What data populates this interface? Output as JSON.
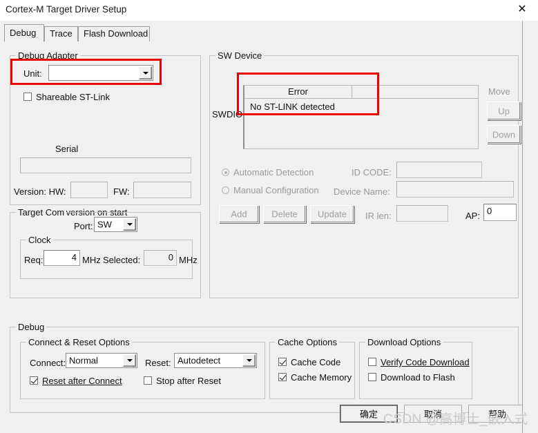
{
  "window": {
    "title": "Cortex-M Target Driver Setup",
    "close_label": "✕"
  },
  "tabs": [
    {
      "label": "Debug",
      "active": true
    },
    {
      "label": "Trace",
      "active": false
    },
    {
      "label": "Flash Download",
      "active": false
    }
  ],
  "debug_adapter": {
    "title": "Debug Adapter",
    "unit_label": "Unit:",
    "unit_value": "",
    "shareable_label": "Shareable ST-Link",
    "shareable_checked": false,
    "serial_label": "Serial",
    "serial_value": "",
    "version_label": "Version: HW:",
    "hw_value": "",
    "fw_label": "FW:",
    "fw_value": "",
    "check_version_label": "Check version on start",
    "check_version_checked": true
  },
  "target_com": {
    "title": "Target Com",
    "port_label": "Port:",
    "port_value": "SW",
    "clock": {
      "title": "Clock",
      "req_label": "Req:",
      "req_value": "4",
      "req_unit": "MHz",
      "selected_label": "Selected:",
      "selected_value": "0",
      "selected_unit": "MHz"
    }
  },
  "sw_device": {
    "title": "SW Device",
    "signal_label": "SWDIO",
    "columns": [
      "",
      "Error",
      ""
    ],
    "rows": [
      {
        "error": "No ST-LINK detected"
      }
    ],
    "move_label": "Move",
    "up_label": "Up",
    "down_label": "Down",
    "automatic_detection_label": "Automatic Detection",
    "automatic_detection_selected": true,
    "manual_configuration_label": "Manual Configuration",
    "manual_configuration_selected": false,
    "id_code_label": "ID CODE:",
    "id_code_value": "",
    "device_name_label": "Device Name:",
    "device_name_value": "",
    "ir_len_label": "IR len:",
    "ir_len_value": "",
    "ap_label": "AP:",
    "ap_value": "0",
    "add_label": "Add",
    "delete_label": "Delete",
    "update_label": "Update"
  },
  "debug_section": {
    "title": "Debug",
    "connect_reset": {
      "title": "Connect & Reset Options",
      "connect_label": "Connect:",
      "connect_value": "Normal",
      "reset_label": "Reset:",
      "reset_value": "Autodetect",
      "reset_after_connect_label": "Reset after Connect",
      "reset_after_connect_accel": "R",
      "reset_after_connect_checked": true,
      "stop_after_reset_label": "Stop after Reset",
      "stop_after_reset_checked": false
    },
    "cache_options": {
      "title": "Cache Options",
      "cache_code_label": "Cache Code",
      "cache_code_accel": "C",
      "cache_code_checked": true,
      "cache_memory_label": "Cache Memory",
      "cache_memory_accel": "M",
      "cache_memory_checked": true
    },
    "download_options": {
      "title": "Download Options",
      "verify_label": "Verify Code Download",
      "verify_accel": "V",
      "verify_checked": false,
      "flash_label": "Download to Flash",
      "flash_accel": "F",
      "flash_checked": false
    }
  },
  "footer": {
    "ok_label": "确定",
    "cancel_label": "取消",
    "help_label": "帮助"
  },
  "watermark": {
    "text": "CSDN @高博士_嵌入式"
  },
  "annotations": {
    "colors": {
      "highlight": "#ee0000"
    },
    "boxes": [
      {
        "name": "unit-field-highlight"
      },
      {
        "name": "error-message-highlight"
      }
    ]
  }
}
